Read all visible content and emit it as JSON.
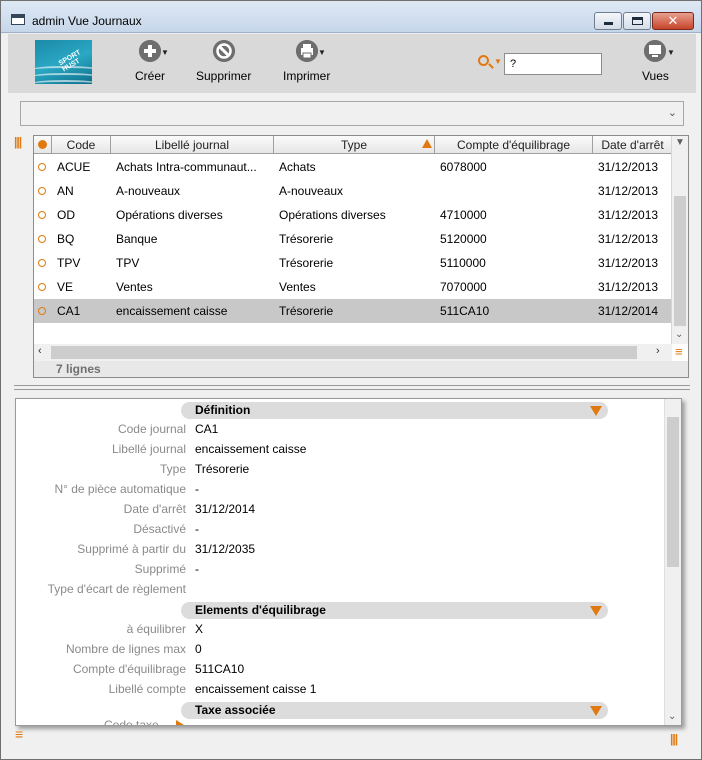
{
  "window": {
    "title": "admin Vue Journaux"
  },
  "window_controls": {
    "minimize": "",
    "maximize": "",
    "close": "✕"
  },
  "toolbar": {
    "logo_text": "SPORT HUST",
    "create_label": "Créer",
    "delete_label": "Supprimer",
    "print_label": "Imprimer",
    "views_label": "Vues",
    "search_value": "?"
  },
  "table": {
    "columns": [
      "Code",
      "Libellé journal",
      "Type",
      "Compte d'équilibrage",
      "Date d'arrêt"
    ],
    "rows": [
      {
        "code": "ACUE",
        "libelle": "Achats Intra-communaut...",
        "type": "Achats",
        "compte": "6078000",
        "date": "31/12/2013"
      },
      {
        "code": "AN",
        "libelle": "A-nouveaux",
        "type": "A-nouveaux",
        "compte": "",
        "date": "31/12/2013"
      },
      {
        "code": "OD",
        "libelle": "Opérations diverses",
        "type": "Opérations diverses",
        "compte": "4710000",
        "date": "31/12/2013"
      },
      {
        "code": "BQ",
        "libelle": "Banque",
        "type": "Trésorerie",
        "compte": "5120000",
        "date": "31/12/2013"
      },
      {
        "code": "TPV",
        "libelle": "TPV",
        "type": "Trésorerie",
        "compte": "5110000",
        "date": "31/12/2013"
      },
      {
        "code": "VE",
        "libelle": "Ventes",
        "type": "Ventes",
        "compte": "7070000",
        "date": "31/12/2013"
      },
      {
        "code": "CA1",
        "libelle": "encaissement caisse",
        "type": "Trésorerie",
        "compte": "511CA10",
        "date": "31/12/2014"
      }
    ],
    "selected_row": 6,
    "row_count": "7 lignes"
  },
  "detail": {
    "sections": [
      {
        "title": "Définition",
        "fields": [
          {
            "label": "Code journal",
            "value": "CA1"
          },
          {
            "label": "Libellé journal",
            "value": "encaissement caisse"
          },
          {
            "label": "Type",
            "value": "Trésorerie"
          },
          {
            "label": "N° de pièce automatique",
            "value": "-"
          },
          {
            "label": "Date d'arrêt",
            "value": "31/12/2014"
          },
          {
            "label": "Désactivé",
            "value": "-"
          },
          {
            "label": "Supprimé à partir du",
            "value": "31/12/2035"
          },
          {
            "label": "Supprimé",
            "value": "-"
          },
          {
            "label": "Type d'écart de règlement",
            "value": ""
          }
        ]
      },
      {
        "title": "Elements d'équilibrage",
        "fields": [
          {
            "label": "à équilibrer",
            "value": "X"
          },
          {
            "label": "Nombre de lignes max",
            "value": "0"
          },
          {
            "label": "Compte d'équilibrage",
            "value": "511CA10"
          },
          {
            "label": "Libellé compte",
            "value": "encaissement caisse 1"
          }
        ]
      },
      {
        "title": "Taxe associée",
        "fields": []
      }
    ],
    "tail_label": "Code taxe"
  },
  "colors": {
    "accent": "#e07a10",
    "selected_row": "#c8c8c8",
    "toolbar": "#d9d9d9"
  }
}
